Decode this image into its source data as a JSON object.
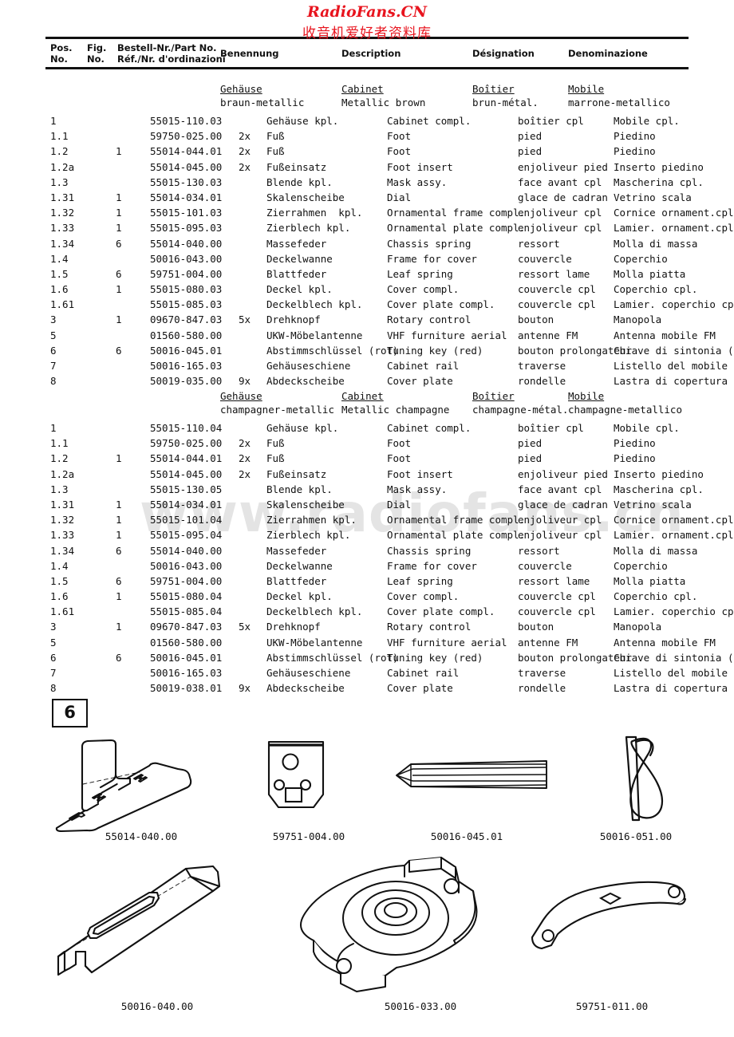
{
  "watermark": {
    "top_line1": "RadioFans.CN",
    "top_line2": "收音机爱好者资料库",
    "center": "www.radiofans.cn",
    "color": "#e8141e"
  },
  "table": {
    "headers": {
      "pos_line1": "Pos.",
      "pos_line2": "No.",
      "fig_line1": "Fig.",
      "fig_line2": "No.",
      "order_line1": "Bestell-Nr./Part No.",
      "order_line2": "Réf./Nr. d'ordinazioni",
      "benennung": "Benennung",
      "description": "Description",
      "designation": "Désignation",
      "denominazione": "Denominazione"
    },
    "sections": [
      {
        "title_de": "Gehäuse",
        "sub_de": "braun-metallic",
        "title_en": "Cabinet",
        "sub_en": "Metallic brown",
        "title_fr": "Boîtier",
        "sub_fr": "brun-métal.",
        "title_it": "Mobile",
        "sub_it": "marrone-metallico",
        "rows": [
          {
            "pos": "1",
            "fig": "",
            "order": "55015-110.03",
            "qty": "",
            "de": "Gehäuse kpl.",
            "en": "Cabinet compl.",
            "fr": "boîtier cpl",
            "it": "Mobile cpl."
          },
          {
            "pos": "1.1",
            "fig": "",
            "order": "59750-025.00",
            "qty": "2x",
            "de": "Fuß",
            "en": "Foot",
            "fr": "pied",
            "it": "Piedino"
          },
          {
            "pos": "1.2",
            "fig": "1",
            "order": "55014-044.01",
            "qty": "2x",
            "de": "Fuß",
            "en": "Foot",
            "fr": "pied",
            "it": "Piedino"
          },
          {
            "pos": "1.2a",
            "fig": "",
            "order": "55014-045.00",
            "qty": "2x",
            "de": "Fußeinsatz",
            "en": "Foot insert",
            "fr": "enjoliveur pied",
            "it": "Inserto piedino"
          },
          {
            "pos": "1.3",
            "fig": "",
            "order": "55015-130.03",
            "qty": "",
            "de": "Blende kpl.",
            "en": "Mask assy.",
            "fr": "face avant cpl",
            "it": "Mascherina cpl."
          },
          {
            "pos": "1.31",
            "fig": "1",
            "order": "55014-034.01",
            "qty": "",
            "de": "Skalenscheibe",
            "en": "Dial",
            "fr": "glace de cadran",
            "it": "Vetrino scala"
          },
          {
            "pos": "1.32",
            "fig": "1",
            "order": "55015-101.03",
            "qty": "",
            "de": "Zierrahmen  kpl.",
            "en": "Ornamental frame compl.",
            "fr": "enjoliveur cpl",
            "it": "Cornice ornament.cpl."
          },
          {
            "pos": "1.33",
            "fig": "1",
            "order": "55015-095.03",
            "qty": "",
            "de": "Zierblech kpl.",
            "en": "Ornamental plate compl.",
            "fr": "enjoliveur cpl",
            "it": "Lamier. ornament.cpl."
          },
          {
            "pos": "1.34",
            "fig": "6",
            "order": "55014-040.00",
            "qty": "",
            "de": "Massefeder",
            "en": "Chassis spring",
            "fr": "ressort",
            "it": "Molla di massa"
          },
          {
            "pos": "1.4",
            "fig": "",
            "order": "50016-043.00",
            "qty": "",
            "de": "Deckelwanne",
            "en": "Frame for cover",
            "fr": "couvercle",
            "it": "Coperchio"
          },
          {
            "pos": "1.5",
            "fig": "6",
            "order": "59751-004.00",
            "qty": "",
            "de": "Blattfeder",
            "en": "Leaf spring",
            "fr": "ressort lame",
            "it": "Molla piatta"
          },
          {
            "pos": "1.6",
            "fig": "1",
            "order": "55015-080.03",
            "qty": "",
            "de": "Deckel kpl.",
            "en": "Cover compl.",
            "fr": "couvercle cpl",
            "it": "Coperchio cpl."
          },
          {
            "pos": "1.61",
            "fig": "",
            "order": "55015-085.03",
            "qty": "",
            "de": "Deckelblech kpl.",
            "en": "Cover plate compl.",
            "fr": "couvercle cpl",
            "it": "Lamier. coperchio cpl."
          },
          {
            "pos": "3",
            "fig": "1",
            "order": "09670-847.03",
            "qty": "5x",
            "de": "Drehknopf",
            "en": "Rotary control",
            "fr": "bouton",
            "it": "Manopola"
          },
          {
            "pos": "5",
            "fig": "",
            "order": "01560-580.00",
            "qty": "",
            "de": "UKW-Möbelantenne",
            "en": "VHF furniture aerial",
            "fr": "antenne FM",
            "it": "Antenna mobile FM"
          },
          {
            "pos": "6",
            "fig": "6",
            "order": "50016-045.01",
            "qty": "",
            "de": "Abstimmschlüssel (rot)",
            "en": "Tuning key (red)",
            "fr": "bouton prolongateur",
            "it": "Chiave di sintonia (rossa)"
          },
          {
            "pos": "7",
            "fig": "",
            "order": "50016-165.03",
            "qty": "",
            "de": "Gehäuseschiene",
            "en": "Cabinet rail",
            "fr": "traverse",
            "it": "Listello del mobile"
          },
          {
            "pos": "8",
            "fig": "",
            "order": "50019-035.00",
            "qty": "9x",
            "de": "Abdeckscheibe",
            "en": "Cover plate",
            "fr": "rondelle",
            "it": "Lastra di copertura"
          }
        ]
      },
      {
        "title_de": "Gehäuse",
        "sub_de": "champagner-metallic",
        "title_en": "Cabinet",
        "sub_en": "Metallic champagne",
        "title_fr": "Boîtier",
        "sub_fr": "champagne-métal.",
        "title_it": "Mobile",
        "sub_it": "champagne-metallico",
        "rows": [
          {
            "pos": "1",
            "fig": "",
            "order": "55015-110.04",
            "qty": "",
            "de": "Gehäuse kpl.",
            "en": "Cabinet compl.",
            "fr": "boîtier cpl",
            "it": "Mobile cpl."
          },
          {
            "pos": "1.1",
            "fig": "",
            "order": "59750-025.00",
            "qty": "2x",
            "de": "Fuß",
            "en": "Foot",
            "fr": "pied",
            "it": "Piedino"
          },
          {
            "pos": "1.2",
            "fig": "1",
            "order": "55014-044.01",
            "qty": "2x",
            "de": "Fuß",
            "en": "Foot",
            "fr": "pied",
            "it": "Piedino"
          },
          {
            "pos": "1.2a",
            "fig": "",
            "order": "55014-045.00",
            "qty": "2x",
            "de": "Fußeinsatz",
            "en": "Foot insert",
            "fr": "enjoliveur pied",
            "it": "Inserto piedino"
          },
          {
            "pos": "1.3",
            "fig": "",
            "order": "55015-130.05",
            "qty": "",
            "de": "Blende kpl.",
            "en": "Mask assy.",
            "fr": "face avant cpl",
            "it": "Mascherina cpl."
          },
          {
            "pos": "1.31",
            "fig": "1",
            "order": "55014-034.01",
            "qty": "",
            "de": "Skalenscheibe",
            "en": "Dial",
            "fr": "glace de cadran",
            "it": "Vetrino scala"
          },
          {
            "pos": "1.32",
            "fig": "1",
            "order": "55015-101.04",
            "qty": "",
            "de": "Zierrahmen kpl.",
            "en": "Ornamental frame compl.",
            "fr": "enjoliveur cpl",
            "it": "Cornice ornament.cpl."
          },
          {
            "pos": "1.33",
            "fig": "1",
            "order": "55015-095.04",
            "qty": "",
            "de": "Zierblech kpl.",
            "en": "Ornamental plate compl.",
            "fr": "enjoliveur cpl",
            "it": "Lamier. ornament.cpl."
          },
          {
            "pos": "1.34",
            "fig": "6",
            "order": "55014-040.00",
            "qty": "",
            "de": "Massefeder",
            "en": "Chassis spring",
            "fr": "ressort",
            "it": "Molla di massa"
          },
          {
            "pos": "1.4",
            "fig": "",
            "order": "50016-043.00",
            "qty": "",
            "de": "Deckelwanne",
            "en": "Frame for cover",
            "fr": "couvercle",
            "it": "Coperchio"
          },
          {
            "pos": "1.5",
            "fig": "6",
            "order": "59751-004.00",
            "qty": "",
            "de": "Blattfeder",
            "en": "Leaf spring",
            "fr": "ressort lame",
            "it": "Molla piatta"
          },
          {
            "pos": "1.6",
            "fig": "1",
            "order": "55015-080.04",
            "qty": "",
            "de": "Deckel kpl.",
            "en": "Cover compl.",
            "fr": "couvercle cpl",
            "it": "Coperchio cpl."
          },
          {
            "pos": "1.61",
            "fig": "",
            "order": "55015-085.04",
            "qty": "",
            "de": "Deckelblech kpl.",
            "en": "Cover plate compl.",
            "fr": "couvercle cpl",
            "it": "Lamier. coperchio cpl."
          },
          {
            "pos": "3",
            "fig": "1",
            "order": "09670-847.03",
            "qty": "5x",
            "de": "Drehknopf",
            "en": "Rotary control",
            "fr": "bouton",
            "it": "Manopola"
          },
          {
            "pos": "5",
            "fig": "",
            "order": "01560-580.00",
            "qty": "",
            "de": "UKW-Möbelantenne",
            "en": "VHF furniture aerial",
            "fr": "antenne FM",
            "it": "Antenna mobile FM"
          },
          {
            "pos": "6",
            "fig": "6",
            "order": "50016-045.01",
            "qty": "",
            "de": "Abstimmschlüssel (rot)",
            "en": "Tuning key (red)",
            "fr": "bouton prolongateur",
            "it": "Chiave di sintonia (rossa"
          },
          {
            "pos": "7",
            "fig": "",
            "order": "50016-165.03",
            "qty": "",
            "de": "Gehäuseschiene",
            "en": "Cabinet rail",
            "fr": "traverse",
            "it": "Listello del mobile"
          },
          {
            "pos": "8",
            "fig": "",
            "order": "50019-038.01",
            "qty": "9x",
            "de": "Abdeckscheibe",
            "en": "Cover plate",
            "fr": "rondelle",
            "it": "Lastra di copertura"
          }
        ]
      }
    ]
  },
  "figure": {
    "badge": "6",
    "captions": {
      "chassis_spring": "55014-040.00",
      "leaf_spring": "59751-004.00",
      "tuning_key": "50016-045.01",
      "clip": "50016-051.00",
      "rail": "50016-040.00",
      "turn_lock": "50016-033.00",
      "strap": "59751-011.00"
    }
  }
}
